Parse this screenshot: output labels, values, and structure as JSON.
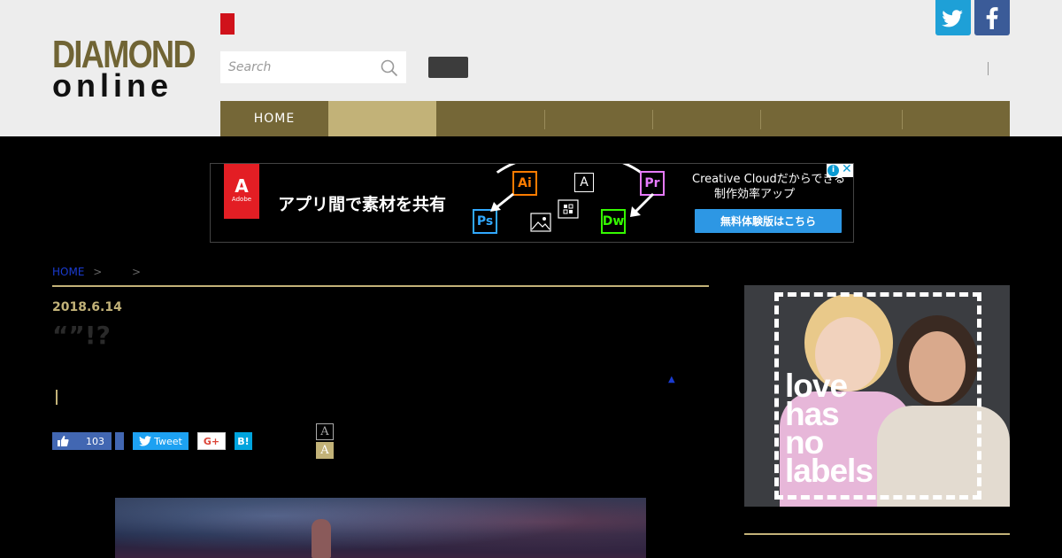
{
  "header": {
    "logo_line1": "DIAMOND",
    "logo_line2": "online",
    "search_placeholder": "Search",
    "social": [
      {
        "name": "twitter",
        "icon": "twitter-bird-icon",
        "color": "#1ea0d7"
      },
      {
        "name": "facebook",
        "icon": "facebook-f-icon",
        "color": "#3b5b98"
      }
    ]
  },
  "nav": {
    "items": [
      {
        "label": "HOME",
        "active": false
      },
      {
        "label": "",
        "active": true
      },
      {
        "label": "",
        "active": false
      },
      {
        "label": "",
        "active": false
      },
      {
        "label": "",
        "active": false
      },
      {
        "label": "",
        "active": false
      },
      {
        "label": "",
        "active": false
      }
    ],
    "colors": {
      "bar": "#756737",
      "active": "#c2b278"
    }
  },
  "ad": {
    "brand": "Adobe",
    "headline": "アプリ間で素材を共有",
    "sub_line1": "Creative Cloudだからできる",
    "sub_line2": "制作効率アップ",
    "cta": "無料体験版はこちら",
    "apps": [
      "Ai",
      "A",
      "Pr",
      "Ps",
      "Dw"
    ]
  },
  "article": {
    "breadcrumb": {
      "home": "HOME",
      "sep": ">"
    },
    "date": "2018.6.14",
    "title": "“”!?",
    "share": {
      "like_count": "103",
      "tweet_label": "Tweet",
      "gplus_label": "G+",
      "hatena_label": "B!"
    },
    "font_size_small": "A",
    "font_size_large": "A"
  },
  "sidebar_ad": {
    "text_line1": "love",
    "text_line2": "has",
    "text_line3": "no",
    "text_line4": "labels"
  }
}
